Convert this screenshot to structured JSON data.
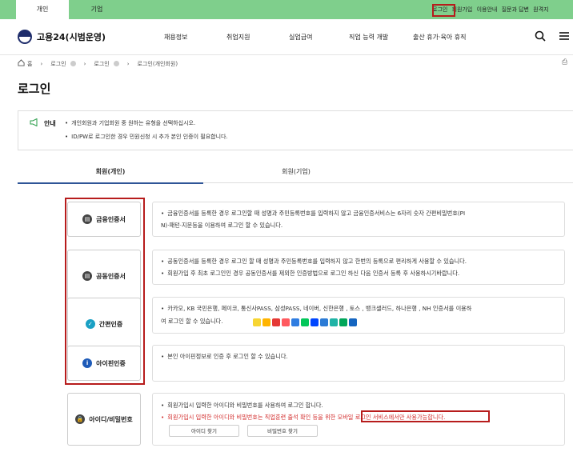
{
  "top_tabs": [
    "개인",
    "기업"
  ],
  "top_links": [
    "로그인",
    "회원가입",
    "이용안내",
    "질문과 답변",
    "원격지"
  ],
  "header": {
    "logo_text": "고용24(시범운영)",
    "nav": [
      "채용정보",
      "취업지원",
      "실업급여",
      "직업 능력 개발",
      "출산 휴가·육아 휴직"
    ],
    "search_icon": "search-icon",
    "menu_icon": "menu-icon"
  },
  "breadcrumb": [
    "홈",
    "로그인",
    "로그인",
    "로그인(개인회원)"
  ],
  "page_title": "로그인",
  "notice": {
    "label": "안내",
    "lines": [
      "개인회원과 기업회원 중 원하는 유형을 선택하십시오.",
      "ID/PW로 로그인한 경우 민원신청 시 추가 본인 인증이 필요합니다."
    ]
  },
  "member_tabs": [
    "회원(개인)",
    "회원(기업)"
  ],
  "methods": [
    {
      "label": "금융인증서",
      "icon": "certificate-icon",
      "icon_color": "#444444",
      "desc": [
        "금융인증서를 등록한 경우 로그인할 때 성명과 주민등록번호를 입력하지 않고 금융인증서비스는 6자리 숫자 간편비밀번호(PI",
        "N)·패턴·지문등을 이용하여 로그인 할 수 있습니다."
      ]
    },
    {
      "label": "공동인증서",
      "icon": "certificate-icon",
      "icon_color": "#444444",
      "desc": [
        "공동인증서를 등록한 경우 로그인 할 때 성명과 주민등록번호를 입력하지 않고 한번의 등록으로 편리하게 사용할 수 있습니다.",
        "회원가입 후 최초 로그인인 경우 공동인증서를 제외한 인증방법으로 로그인 하신 다음 인증서 등록 후 사용하시기바랍니다."
      ]
    },
    {
      "label": "간편인증",
      "icon": "check-badge-icon",
      "icon_color": "#1aa0c4",
      "desc": [
        "카카오, KB 국민은행, 페이코, 통신사PASS, 삼성PASS, 네이버, 신한은행 , 토스 , 뱅크샐러드, 하나은행 , NH 인증서를 이용하",
        "여 로그인 할 수 있습니다."
      ]
    },
    {
      "label": "아이핀인증",
      "icon": "info-icon",
      "icon_color": "#1e5bb8",
      "desc": [
        "본인 아이핀정보로 인증 후 로그인 할 수 있습니다."
      ]
    },
    {
      "label": "아이디/비밀번호",
      "icon": "lock-icon",
      "icon_color": "#444444",
      "desc": [
        "회원가입시 입력한 아이디와 비밀번호를 사용하여 로그인 합니다.",
        "회원가입시 입력한 아이디와 비밀번호는 직업훈련 출석 확인 등을 위한 모바일 로그인 서비스에서만 사용가능합니다."
      ]
    }
  ],
  "id_buttons": [
    "아이디 찾기",
    "비밀번호 찾기"
  ],
  "bank_icon_colors": [
    "#f7d533",
    "#ffb400",
    "#e53935",
    "#ff5a5f",
    "#2f7de1",
    "#03c75a",
    "#0046ff",
    "#2b7bd6",
    "#1fb3a6",
    "#00a65a",
    "#1565c0"
  ],
  "colors": {
    "top_bar": "#7fcf8c",
    "highlight_red": "#b71c1c",
    "notice_green": "#2a9d4a",
    "tab_active": "#2f5597"
  }
}
